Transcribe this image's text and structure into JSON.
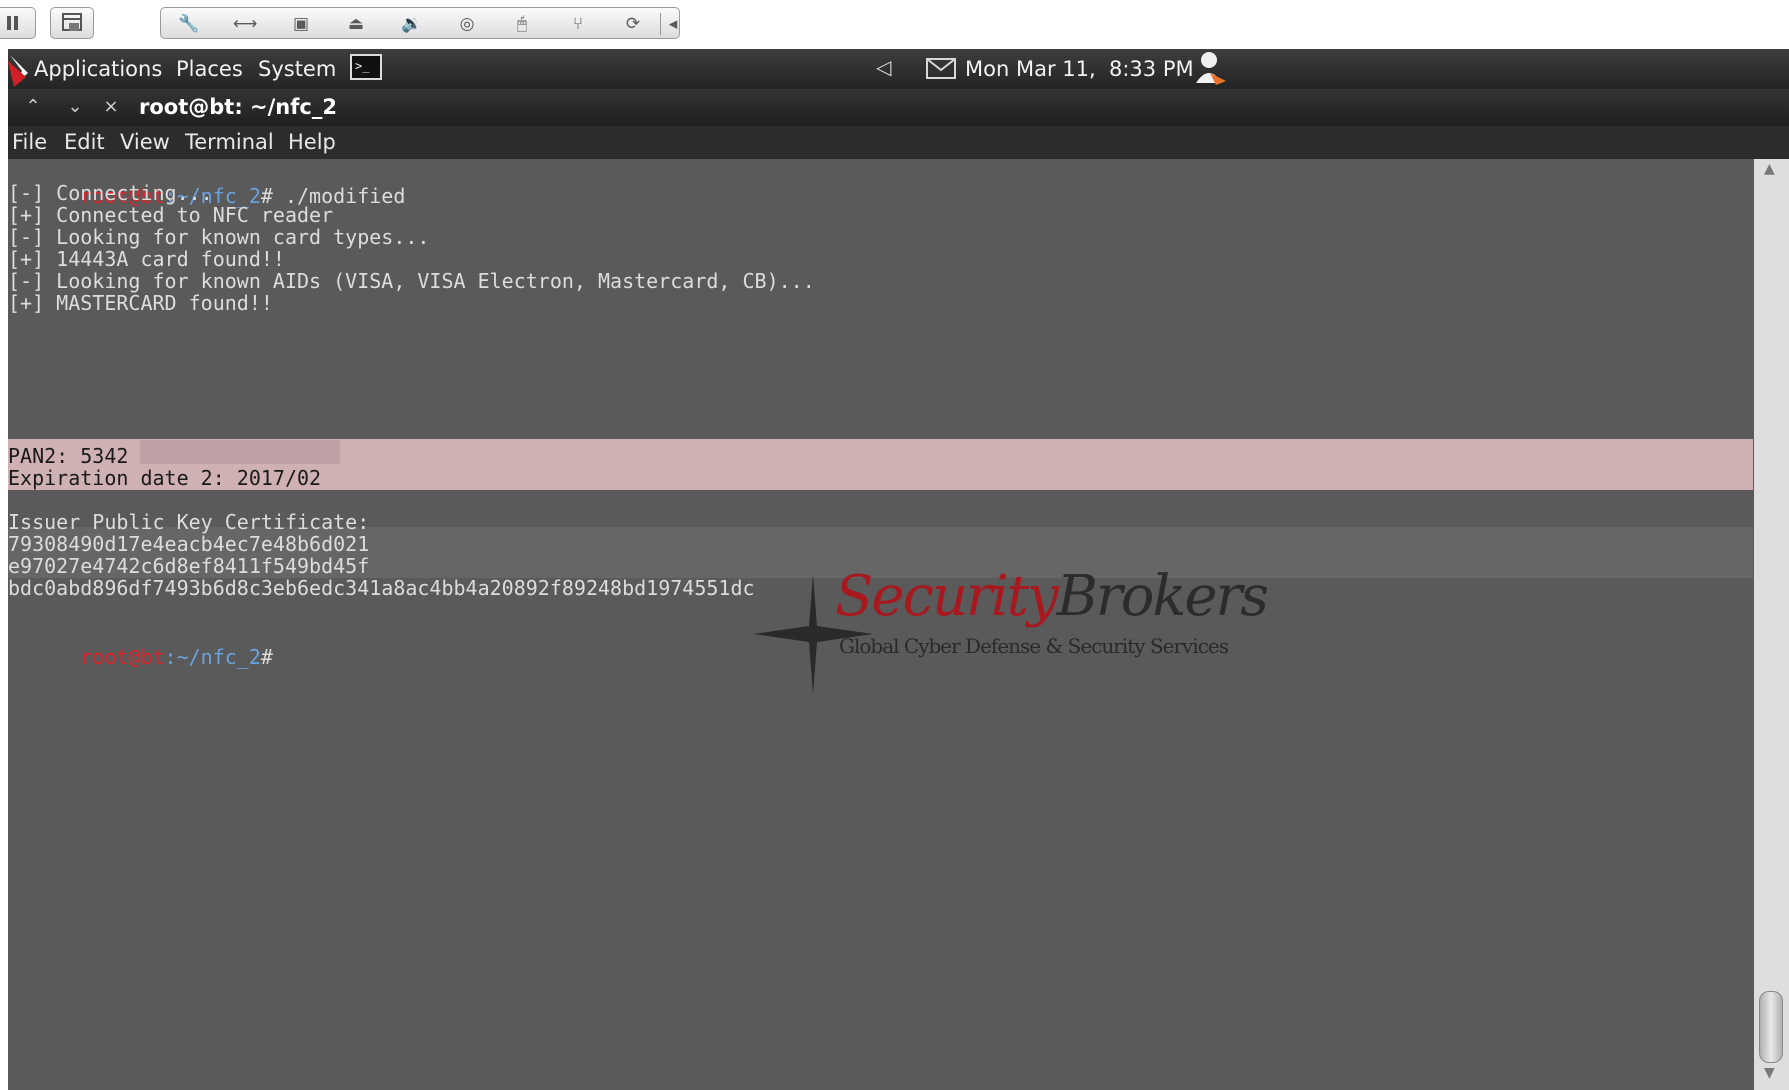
{
  "panel": {
    "menus": [
      "Applications",
      "Places",
      "System"
    ],
    "clock": "Mon Mar 11,  8:33 PM"
  },
  "window": {
    "title": "root@bt: ~/nfc_2",
    "menus": [
      "File",
      "Edit",
      "View",
      "Terminal",
      "Help"
    ]
  },
  "terminal": {
    "prompt_user": "root@bt",
    "prompt_path": ":~/nfc_2",
    "prompt_symbol": "#",
    "command": " ./modified",
    "output": [
      "[-] Connecting...",
      "[+] Connected to NFC reader",
      "[-] Looking for known card types...",
      "[+] 14443A card found!!",
      "[-] Looking for known AIDs (VISA, VISA Electron, Mastercard, CB)...",
      "[+] MASTERCARD found!!"
    ],
    "pan_line": "PAN2: 5342",
    "exp_line": "Expiration date 2: 2017/02",
    "cert_header": "Issuer Public Key Certificate:",
    "cert_lines": [
      "79308490d17e4eacb4ec7e48b6d021",
      "e97027e4742c6d8ef8411f549bd45f",
      "bdc0abd896df7493b6d8c3eb6edc341a8ac4bb4a20892f89248bd1974551dc"
    ]
  },
  "watermark": {
    "brand_red": "Security",
    "brand_dark": "Brokers",
    "tagline": "Global Cyber Defense & Security Services"
  },
  "colors": {
    "prompt_user": "#e0242b",
    "prompt_path": "#6aa2e0",
    "terminal_bg": "#5a5a5a",
    "highlight": "#cfb0b3",
    "brand_red": "#a8191f"
  },
  "icons": [
    "pause-icon",
    "vm-window-icon",
    "wrench-icon",
    "resize-arrows-icon",
    "screenshot-icon",
    "disk-icon",
    "audio-icon",
    "cdrom-icon",
    "mouse-icon",
    "usb-icon",
    "refresh-icon",
    "collapse-arrow-icon",
    "backtrack-logo-icon",
    "terminal-launcher-icon",
    "speaker-icon",
    "mail-icon",
    "user-icon"
  ]
}
